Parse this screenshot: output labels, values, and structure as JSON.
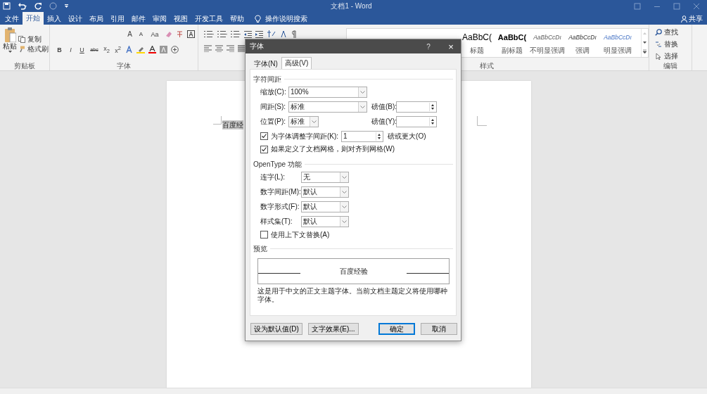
{
  "window": {
    "title": "文档1 - Word"
  },
  "ribbon_tabs": [
    {
      "label": "文件",
      "selected": false
    },
    {
      "label": "开始",
      "selected": true
    },
    {
      "label": "插入",
      "selected": false
    },
    {
      "label": "设计",
      "selected": false
    },
    {
      "label": "布局",
      "selected": false
    },
    {
      "label": "引用",
      "selected": false
    },
    {
      "label": "邮件",
      "selected": false
    },
    {
      "label": "审阅",
      "selected": false
    },
    {
      "label": "视图",
      "selected": false
    },
    {
      "label": "开发工具",
      "selected": false
    },
    {
      "label": "帮助",
      "selected": false
    }
  ],
  "tell_me": "操作说明搜索",
  "share": "共享",
  "clipboard": {
    "paste": "粘贴",
    "copy": "复制",
    "format_painter": "格式刷",
    "label": "剪贴板"
  },
  "font_group": {
    "label": "字体",
    "size_buttons": [
      "A",
      "A",
      "Aa"
    ],
    "format_buttons": [
      "B",
      "I",
      "U",
      "abc",
      "x$_{2}$",
      "x$^{2}$"
    ]
  },
  "styles": {
    "label": "样式",
    "items": [
      {
        "preview": "AaBbC(",
        "name": "标题",
        "kind": "title"
      },
      {
        "preview": "AaBbC(",
        "name": "副标题",
        "kind": "subtitle"
      },
      {
        "preview": "AaBbCcDı",
        "name": "不明显强调",
        "kind": "subtle"
      },
      {
        "preview": "AaBbCcDı",
        "name": "强调",
        "kind": "emphasis"
      },
      {
        "preview": "AaBbCcDı",
        "name": "明显强调",
        "kind": "intense"
      }
    ]
  },
  "editing": {
    "label": "编辑",
    "find": "查找",
    "replace": "替换",
    "select": "选择"
  },
  "document": {
    "text": "百度经"
  },
  "dialog": {
    "title": "字体",
    "help": "?",
    "close": "×",
    "tabs": [
      {
        "label": "字体(N)",
        "selected": false
      },
      {
        "label": "高级(V)",
        "selected": true
      }
    ],
    "spacing_section": "字符间距",
    "scale": {
      "label": "缩放(C):",
      "value": "100%"
    },
    "spacing": {
      "label": "间距(S):",
      "value": "标准",
      "by_label": "磅值(B):"
    },
    "position": {
      "label": "位置(P):",
      "value": "标准",
      "by_label": "磅值(Y):"
    },
    "kerning": {
      "label": "为字体调整字间距(K):",
      "checked": true,
      "value": "1",
      "suffix": "磅或更大(O)"
    },
    "grid": {
      "label": "如果定义了文档网格，则对齐到网格(W)",
      "checked": true
    },
    "opentype_section": "OpenType 功能",
    "opentype": [
      {
        "label": "连字(L):",
        "value": "无"
      },
      {
        "label": "数字间距(M):",
        "value": "默认"
      },
      {
        "label": "数字形式(F):",
        "value": "默认"
      },
      {
        "label": "样式集(T):",
        "value": "默认"
      }
    ],
    "contextual": {
      "label": "使用上下文替换(A)",
      "checked": false
    },
    "preview_section": "预览",
    "preview_text": "百度经验",
    "description": "这是用于中文的正文主题字体。当前文档主题定义将使用哪种字体。",
    "buttons": [
      {
        "label": "设为默认值(D)",
        "kind": "normal"
      },
      {
        "label": "文字效果(E)...",
        "kind": "normal"
      },
      {
        "label": "确定",
        "kind": "default"
      },
      {
        "label": "取消",
        "kind": "normal"
      }
    ]
  }
}
